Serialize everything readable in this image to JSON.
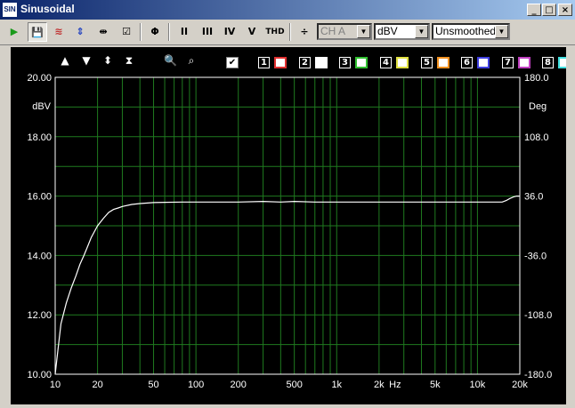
{
  "window": {
    "title": "Sinusoidal",
    "icon_text": "SIN"
  },
  "toolbar": {
    "channel_select": "CH A",
    "unit_select": "dBV",
    "smoothing_select": "Unsmoothed",
    "buttons": [
      {
        "name": "run-button",
        "label": "▶",
        "color": "#1a9a1a"
      },
      {
        "name": "save-button",
        "label": "💾"
      },
      {
        "name": "waveform-button",
        "label": "≋"
      },
      {
        "name": "spin-button",
        "label": "⇕"
      },
      {
        "name": "marker-button",
        "label": "⇹"
      },
      {
        "name": "check-button",
        "label": "☑"
      },
      {
        "name": "phase-button",
        "label": "Φ"
      },
      {
        "name": "harmonic-2-button",
        "label": "II"
      },
      {
        "name": "harmonic-3-button",
        "label": "III"
      },
      {
        "name": "harmonic-4-button",
        "label": "IV"
      },
      {
        "name": "harmonic-5-button",
        "label": "V"
      },
      {
        "name": "thd-button",
        "label": "THD"
      },
      {
        "name": "divide-button",
        "label": "÷"
      }
    ]
  },
  "plot_controls": {
    "zoom_in": "🔍",
    "zoom_out": "⌕",
    "master_check": "✔"
  },
  "channels": [
    {
      "num": "1",
      "color": "#e03030"
    },
    {
      "num": "2",
      "color": "#ffffff"
    },
    {
      "num": "3",
      "color": "#30c030"
    },
    {
      "num": "4",
      "color": "#e0e040"
    },
    {
      "num": "5",
      "color": "#f09020"
    },
    {
      "num": "6",
      "color": "#4040e0"
    },
    {
      "num": "7",
      "color": "#c040c0"
    },
    {
      "num": "8",
      "color": "#40e0e0"
    }
  ],
  "chart_data": {
    "type": "line",
    "x_scale": "log",
    "xlim": [
      10,
      20000
    ],
    "ylim": [
      10,
      20
    ],
    "y2lim": [
      -180,
      180
    ],
    "ylabel": "dBV",
    "y2label": "Deg",
    "xunit": "Hz",
    "x_tick_labels": [
      "10",
      "20",
      "50",
      "100",
      "200",
      "500",
      "1k",
      "2k",
      "5k",
      "10k",
      "20k"
    ],
    "x_tick_values": [
      10,
      20,
      50,
      100,
      200,
      500,
      1000,
      2000,
      5000,
      10000,
      20000
    ],
    "y_tick_labels": [
      "20.00",
      "18.00",
      "16.00",
      "14.00",
      "12.00",
      "10.00"
    ],
    "y_tick_values": [
      20,
      18,
      16,
      14,
      12,
      10
    ],
    "y2_tick_labels": [
      "180.0",
      "108.0",
      "36.0",
      "-36.0",
      "-108.0",
      "-180.0"
    ],
    "grid": true,
    "trace_color": "#ffffff",
    "grid_color": "#1f7a1f",
    "series": [
      {
        "x": [
          10,
          10.5,
          11,
          12,
          13,
          14,
          15,
          16,
          17,
          18,
          20,
          22,
          24,
          26,
          28,
          30,
          35,
          40,
          50,
          60,
          80,
          100,
          150,
          200,
          300,
          400,
          500,
          700,
          1000,
          2000,
          3000,
          5000,
          7000,
          10000,
          15000,
          16000,
          17000,
          18000,
          19000,
          20000
        ],
        "y": [
          10.0,
          10.9,
          11.7,
          12.4,
          12.9,
          13.3,
          13.7,
          14.0,
          14.3,
          14.6,
          15.0,
          15.25,
          15.45,
          15.55,
          15.6,
          15.65,
          15.72,
          15.75,
          15.78,
          15.79,
          15.8,
          15.8,
          15.8,
          15.8,
          15.82,
          15.8,
          15.82,
          15.8,
          15.8,
          15.8,
          15.8,
          15.8,
          15.8,
          15.8,
          15.8,
          15.85,
          15.92,
          15.97,
          16.0,
          16.0
        ]
      }
    ]
  }
}
